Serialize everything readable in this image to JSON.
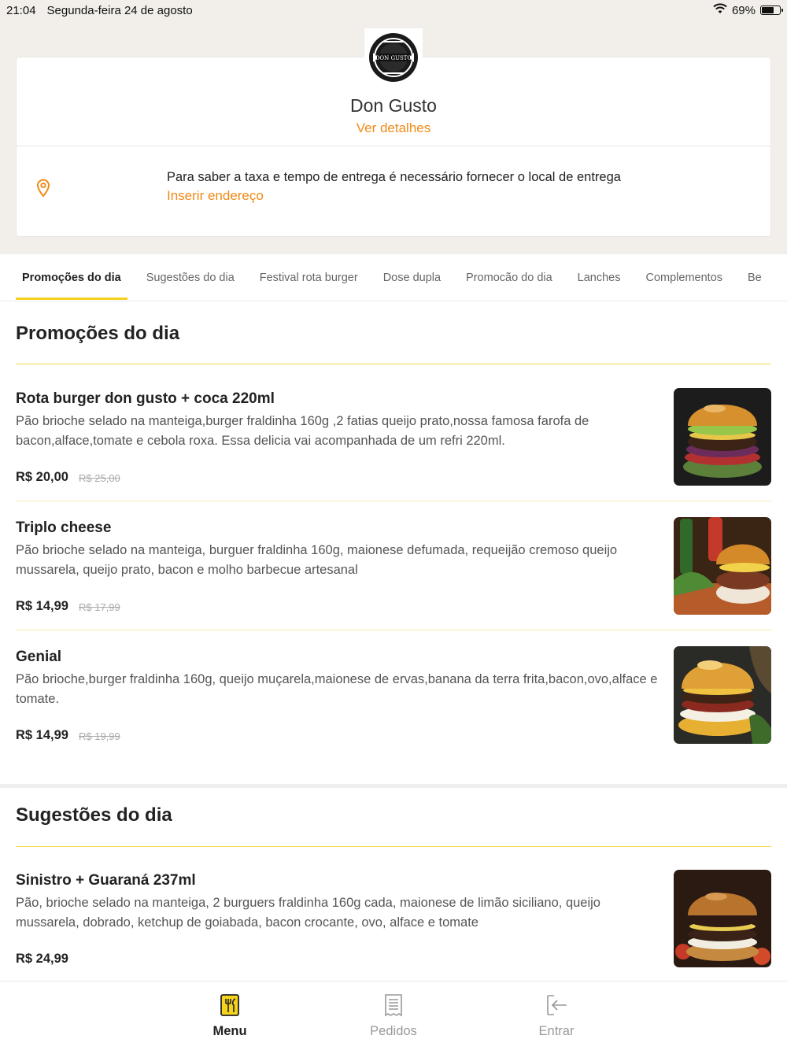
{
  "status_bar": {
    "time": "21:04",
    "date": "Segunda-feira 24 de agosto",
    "battery": "69%"
  },
  "store": {
    "logo_text": "DON GUSTO",
    "name": "Don Gusto",
    "details_link": "Ver detalhes",
    "delivery_info": "Para saber a taxa e tempo de entrega é necessário fornecer o local de entrega",
    "insert_address": "Inserir endereço"
  },
  "tabs": [
    {
      "label": "Promoções do dia"
    },
    {
      "label": "Sugestões do dia"
    },
    {
      "label": "Festival rota burger"
    },
    {
      "label": "Dose dupla"
    },
    {
      "label": "Promocão do dia"
    },
    {
      "label": "Lanches"
    },
    {
      "label": "Complementos"
    },
    {
      "label": "Be"
    }
  ],
  "sections": [
    {
      "title": "Promoções do dia",
      "items": [
        {
          "name": "Rota burger don gusto + coca 220ml",
          "description": "Pão brioche selado na manteiga,burger fraldinha 160g ,2 fatias queijo prato,nossa famosa farofa de bacon,alface,tomate e cebola roxa. Essa delicia vai acompanhada de um refri 220ml.",
          "price": "R$ 20,00",
          "old_price": "R$ 25,00"
        },
        {
          "name": "Triplo cheese",
          "description": "Pão brioche selado na manteiga, burguer fraldinha 160g, maionese defumada, requeijão cremoso queijo mussarela, queijo prato, bacon e molho barbecue artesanal",
          "price": "R$ 14,99",
          "old_price": "R$ 17,99"
        },
        {
          "name": "Genial",
          "description": "Pão brioche,burger fraldinha 160g, queijo muçarela,maionese de ervas,banana da terra frita,bacon,ovo,alface e tomate.",
          "price": "R$ 14,99",
          "old_price": "R$ 19,99"
        }
      ]
    },
    {
      "title": "Sugestões do dia",
      "items": [
        {
          "name": "Sinistro + Guaraná 237ml",
          "description": "Pão, brioche selado na manteiga, 2 burguers fraldinha 160g cada, maionese de limão siciliano, queijo mussarela, dobrado, ketchup de goiabada, bacon crocante, ovo, alface e tomate",
          "price": "R$ 24,99"
        }
      ]
    }
  ],
  "bottom_nav": {
    "menu": "Menu",
    "orders": "Pedidos",
    "login": "Entrar"
  },
  "colors": {
    "accent_orange": "#f08a16",
    "accent_yellow": "#f5d21e",
    "header_bg": "#f2efeb"
  },
  "icons": {
    "location": "map-pin-icon",
    "menu": "utensils-icon",
    "orders": "receipt-icon",
    "login": "sign-in-icon"
  }
}
